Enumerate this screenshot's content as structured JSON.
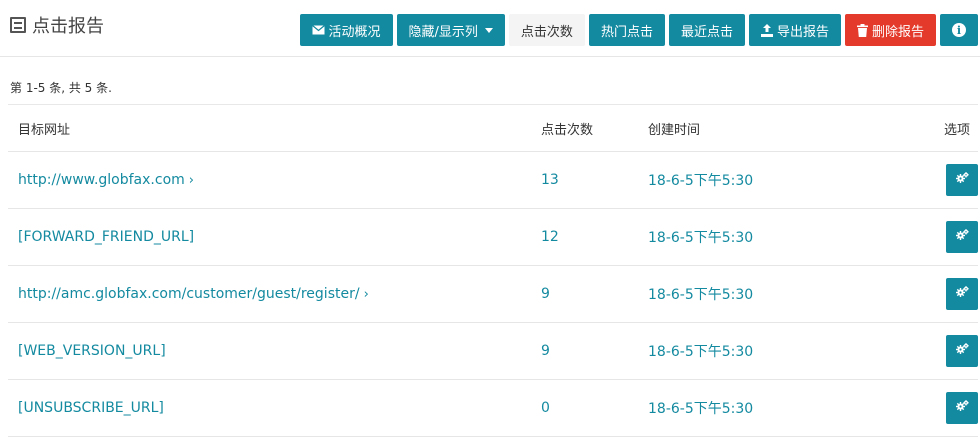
{
  "header": {
    "title": "点击报告",
    "buttons": {
      "overview": "活动概况",
      "columns": "隐藏/显示列",
      "clicks": "点击次数",
      "hot": "热门点击",
      "recent": "最近点击",
      "export": "导出报告",
      "delete": "删除报告"
    }
  },
  "summary": "第 1-5 条, 共 5 条.",
  "table": {
    "headers": {
      "url": "目标网址",
      "clicks": "点击次数",
      "created": "创建时间",
      "options": "选项"
    },
    "rows": [
      {
        "url": "http://www.globfax.com",
        "has_arrow": true,
        "clicks": "13",
        "created": "18-6-5下午5:30"
      },
      {
        "url": "[FORWARD_FRIEND_URL]",
        "has_arrow": false,
        "clicks": "12",
        "created": "18-6-5下午5:30"
      },
      {
        "url": "http://amc.globfax.com/customer/guest/register/",
        "has_arrow": true,
        "clicks": "9",
        "created": "18-6-5下午5:30"
      },
      {
        "url": "[WEB_VERSION_URL]",
        "has_arrow": false,
        "clicks": "9",
        "created": "18-6-5下午5:30"
      },
      {
        "url": "[UNSUBSCRIBE_URL]",
        "has_arrow": false,
        "clicks": "0",
        "created": "18-6-5下午5:30"
      }
    ]
  },
  "colors": {
    "accent": "#148aa0",
    "danger": "#e33a2c",
    "plain": "#f4f4f4"
  },
  "icons": {
    "title": "list-icon",
    "overview": "envelope-icon",
    "columns": "caret-down-icon",
    "export": "upload-icon",
    "delete": "trash-icon",
    "info": "info-icon",
    "row_action": "gears-icon",
    "url_arrow": "chevron-right-icon"
  }
}
